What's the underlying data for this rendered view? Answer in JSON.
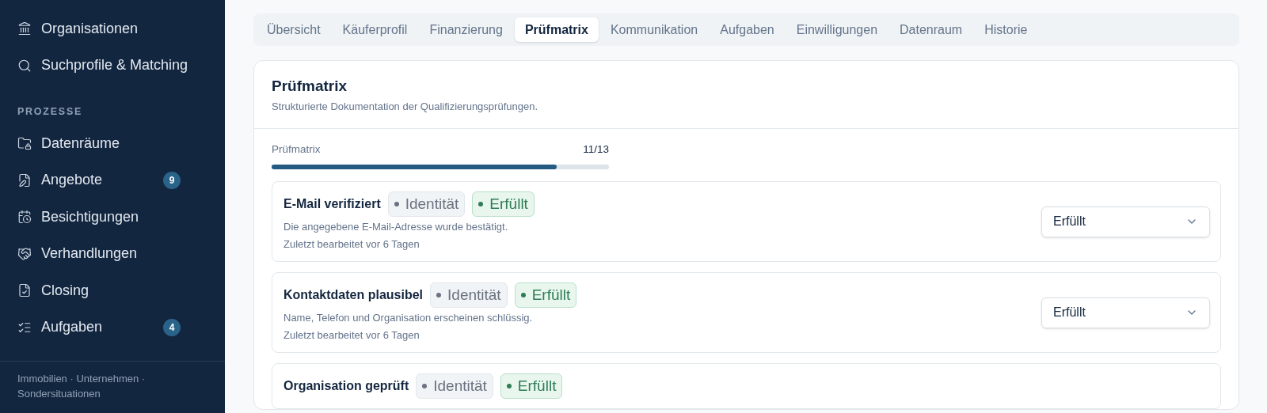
{
  "sidebar": {
    "top_items": [
      {
        "label": "Organisationen"
      },
      {
        "label": "Suchprofile & Matching"
      }
    ],
    "section_label": "PROZESSE",
    "items": [
      {
        "label": "Datenräume"
      },
      {
        "label": "Angebote",
        "badge": "9"
      },
      {
        "label": "Besichtigungen"
      },
      {
        "label": "Verhandlungen"
      },
      {
        "label": "Closing"
      },
      {
        "label": "Aufgaben",
        "badge": "4"
      }
    ],
    "footer": "Immobilien · Unternehmen · Sondersituationen"
  },
  "tabs": [
    {
      "label": "Übersicht",
      "selected": false
    },
    {
      "label": "Käuferprofil",
      "selected": false
    },
    {
      "label": "Finanzierung",
      "selected": false
    },
    {
      "label": "Prüfmatrix",
      "selected": true
    },
    {
      "label": "Kommunikation",
      "selected": false
    },
    {
      "label": "Aufgaben",
      "selected": false
    },
    {
      "label": "Einwilligungen",
      "selected": false
    },
    {
      "label": "Datenraum",
      "selected": false
    },
    {
      "label": "Historie",
      "selected": false
    }
  ],
  "panel": {
    "title": "Prüfmatrix",
    "subtitle": "Strukturierte Dokumentation der Qualifizierungsprüfungen.",
    "progress": {
      "label": "Prüfmatrix",
      "reading": "11/13",
      "level": 0.846
    },
    "checks": [
      {
        "title": "E-Mail verifiziert",
        "tags": [
          {
            "label": "Identität",
            "color": "#6b7280"
          },
          {
            "label": "Erfüllt",
            "color": "#2f7d55"
          }
        ],
        "description": "Die angegebene E-Mail-Adresse wurde bestätigt.",
        "edited": "Zuletzt bearbeitet vor 6 Tagen",
        "status_select": "Erfüllt"
      },
      {
        "title": "Kontaktdaten plausibel",
        "tags": [
          {
            "label": "Identität",
            "color": "#6b7280"
          },
          {
            "label": "Erfüllt",
            "color": "#2f7d55"
          }
        ],
        "description": "Name, Telefon und Organisation erscheinen schlüssig.",
        "edited": "Zuletzt bearbeitet vor 6 Tagen",
        "status_select": "Erfüllt"
      },
      {
        "title": "Organisation geprüft",
        "tags": [
          {
            "label": "Identität",
            "color": "#6b7280"
          },
          {
            "label": "Erfüllt",
            "color": "#2f7d55"
          }
        ]
      }
    ]
  }
}
